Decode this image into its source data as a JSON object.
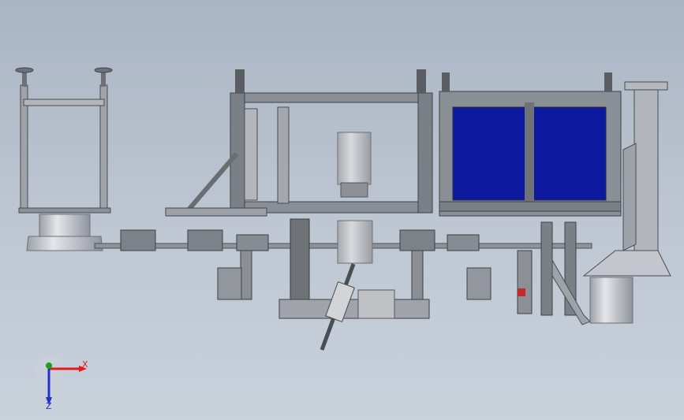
{
  "viewport": {
    "background_top": "#aab5c4",
    "background_bottom": "#c9d1db"
  },
  "model": {
    "frame_color": "#5f6368",
    "steel_light": "#b9bcc2",
    "steel_mid": "#9ea2a9",
    "panel_color": "#0d1aa0",
    "cylinder_color": "#c8cbd3"
  },
  "triad": {
    "x_label": "X",
    "z_label": "Z",
    "x_color": "#e21b1b",
    "y_color": "#1aa11a",
    "z_color": "#2430c8"
  }
}
